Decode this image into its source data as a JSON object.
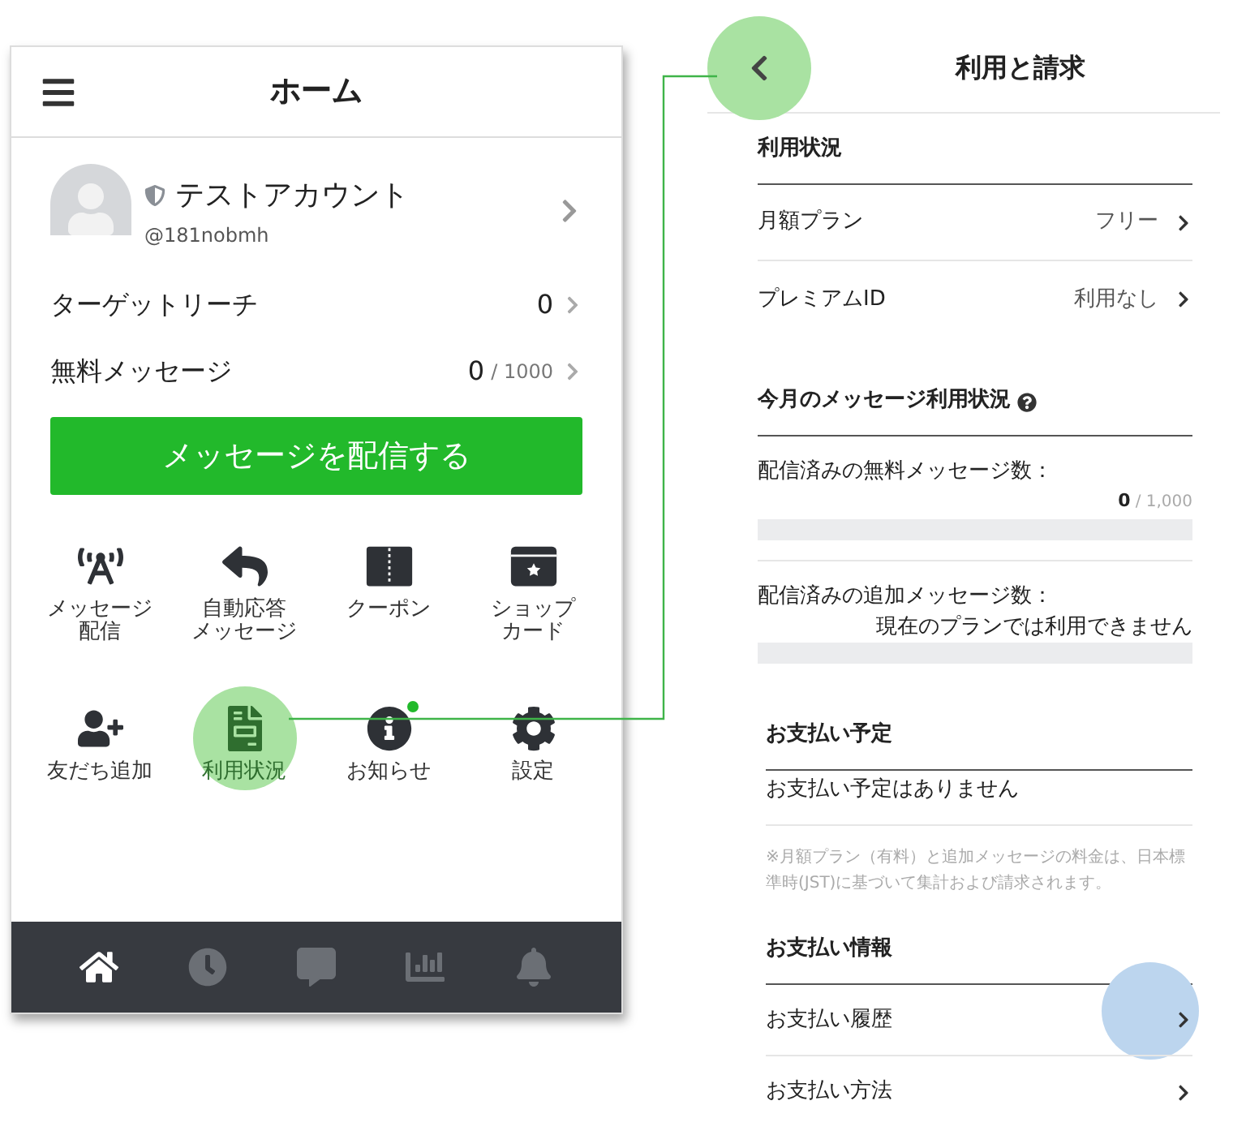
{
  "home": {
    "title": "ホーム",
    "account": {
      "name": "テストアカウント",
      "handle": "@181nobmh"
    },
    "stats": [
      {
        "label": "ターゲットリーチ",
        "value": "0"
      },
      {
        "label": "無料メッセージ",
        "value": "0",
        "total": "/ 1000"
      }
    ],
    "cta": "メッセージを配信する",
    "menu": [
      {
        "kind": "broadcast",
        "label": [
          "メッセージ",
          "配信"
        ],
        "highlighted": false,
        "badge": false
      },
      {
        "kind": "auto-reply",
        "label": [
          "自動応答",
          "メッセージ"
        ],
        "highlighted": false,
        "badge": false
      },
      {
        "kind": "coupon",
        "label": [
          "クーポン"
        ],
        "highlighted": false,
        "badge": false
      },
      {
        "kind": "shop-card",
        "label": [
          "ショップ",
          "カード"
        ],
        "highlighted": false,
        "badge": false
      },
      {
        "kind": "add-friend",
        "label": [
          "友だち追加"
        ],
        "highlighted": false,
        "badge": false
      },
      {
        "kind": "usage",
        "label": [
          "利用状況"
        ],
        "highlighted": true,
        "badge": false
      },
      {
        "kind": "notice",
        "label": [
          "お知らせ"
        ],
        "highlighted": false,
        "badge": true
      },
      {
        "kind": "settings",
        "label": [
          "設定"
        ],
        "highlighted": false,
        "badge": false
      }
    ],
    "nav": [
      {
        "kind": "home",
        "selected": true
      },
      {
        "kind": "clock",
        "selected": false
      },
      {
        "kind": "chat",
        "selected": false
      },
      {
        "kind": "chart",
        "selected": false
      },
      {
        "kind": "bell",
        "selected": false
      }
    ]
  },
  "billing": {
    "title": "利用と請求",
    "back_highlighted": true,
    "usage": {
      "heading": "利用状況",
      "rows": [
        {
          "label": "月額プラン",
          "value": "フリー"
        },
        {
          "label": "プレミアムID",
          "value": "利用なし"
        }
      ]
    },
    "messages": {
      "heading": "今月のメッセージ利用状況",
      "meters": [
        {
          "label": "配信済みの無料メッセージ数：",
          "count": "0",
          "total": "/ 1,000"
        },
        {
          "label": "配信済みの追加メッセージ数：",
          "note": "現在のプランでは利用できません"
        }
      ]
    },
    "schedule": {
      "heading": "お支払い予定",
      "text": "お支払い予定はありません",
      "note": "※月額プラン（有料）と追加メッセージの料金は、日本標準時(JST)に基づいて集計および請求されます。"
    },
    "payment": {
      "heading": "お支払い情報",
      "rows": [
        {
          "label": "お支払い履歴",
          "highlighted": true
        },
        {
          "label": "お支払い方法",
          "highlighted": false
        }
      ]
    }
  }
}
